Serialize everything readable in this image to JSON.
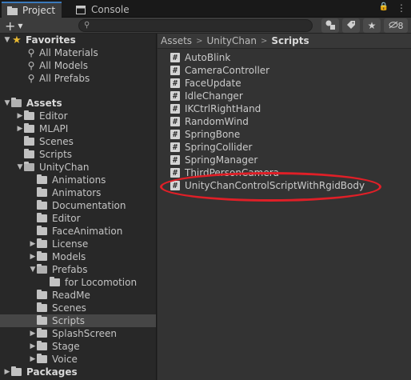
{
  "tabs": [
    {
      "label": "Project",
      "icon": "folder-icon",
      "active": true
    },
    {
      "label": "Console",
      "icon": "console-icon",
      "active": false
    }
  ],
  "tab_actions": {
    "menu": "⋮",
    "lock": "🔒",
    "more": "≡"
  },
  "toolbar": {
    "create": "+",
    "search_placeholder": "",
    "search_value": "",
    "hidden_count": "8"
  },
  "tree": {
    "favorites": {
      "label": "Favorites",
      "items": [
        "All Materials",
        "All Models",
        "All Prefabs"
      ]
    },
    "assets_label": "Assets",
    "nodes": [
      {
        "label": "Editor"
      },
      {
        "label": "MLAPI"
      },
      {
        "label": "Scenes"
      },
      {
        "label": "Scripts"
      },
      {
        "label": "UnityChan"
      },
      {
        "label": "Animations"
      },
      {
        "label": "Animators"
      },
      {
        "label": "Documentation"
      },
      {
        "label": "Editor"
      },
      {
        "label": "FaceAnimation"
      },
      {
        "label": "License"
      },
      {
        "label": "Models"
      },
      {
        "label": "Prefabs"
      },
      {
        "label": "for Locomotion"
      },
      {
        "label": "ReadMe"
      },
      {
        "label": "Scenes"
      },
      {
        "label": "Scripts"
      },
      {
        "label": "SplashScreen"
      },
      {
        "label": "Stage"
      },
      {
        "label": "Voice"
      }
    ],
    "packages_label": "Packages"
  },
  "breadcrumb": [
    "Assets",
    "UnityChan",
    "Scripts"
  ],
  "files": [
    "AutoBlink",
    "CameraController",
    "FaceUpdate",
    "IdleChanger",
    "IKCtrlRightHand",
    "RandomWind",
    "SpringBone",
    "SpringCollider",
    "SpringManager",
    "ThirdPersonCamera",
    "UnityChanControlScriptWithRgidBody"
  ],
  "file_icon_glyph": "#",
  "highlight_color": "#e01f27"
}
